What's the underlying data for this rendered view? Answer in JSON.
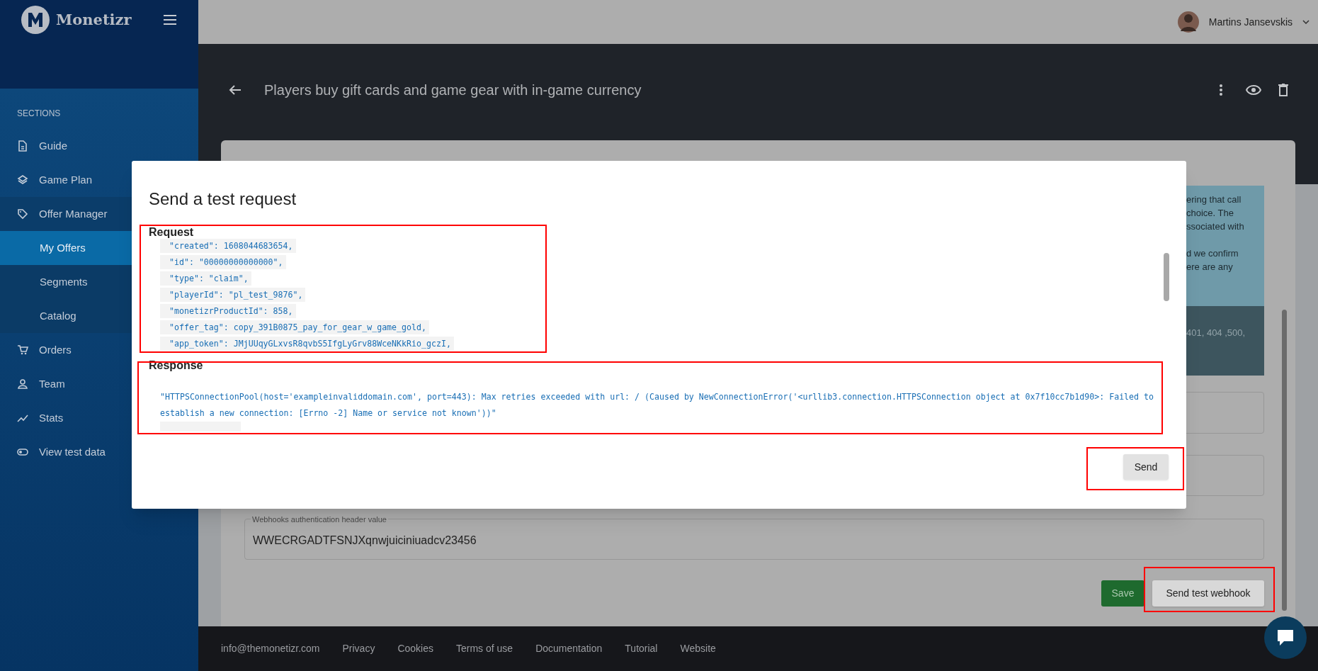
{
  "header": {
    "logo": "Monetizr",
    "user": "Martins Jansevskis"
  },
  "sidebar": {
    "section_title": "SECTIONS",
    "items": [
      {
        "label": "Guide",
        "selected": false
      },
      {
        "label": "Game Plan",
        "selected": false
      },
      {
        "label": "Offer Manager",
        "selected": false,
        "expanded": true,
        "children": [
          {
            "label": "My Offers",
            "selected": true
          },
          {
            "label": "Segments",
            "selected": false
          },
          {
            "label": "Catalog",
            "selected": false
          }
        ]
      },
      {
        "label": "Orders",
        "selected": false
      },
      {
        "label": "Team",
        "selected": false
      },
      {
        "label": "Stats",
        "selected": false
      },
      {
        "label": "View test data",
        "selected": false
      }
    ]
  },
  "page": {
    "title": "Players buy gift cards and game gear with in-game currency",
    "info_paragraphs": [
      [
        "ering that call",
        "choice. The",
        "ssociated with"
      ],
      [
        "d we confirm",
        "ere are any"
      ]
    ],
    "codes_fragment": "401, 404 ,500,",
    "auth_field": {
      "label": "Webhooks authentication header value",
      "value": "WWECRGADTFSNJXqnwjuiciniuadcv23456"
    },
    "buttons": [
      "Save",
      "Send test webhook"
    ]
  },
  "footer": {
    "links": [
      "info@themonetizr.com",
      "Privacy",
      "Cookies",
      "Terms of use",
      "Documentation",
      "Tutorial",
      "Website"
    ]
  },
  "modal": {
    "title": "Send a test request",
    "request_heading": "Request",
    "request_lines": [
      "\"created\": 1608044683654,",
      "\"id\": \"00000000000000\",",
      "\"type\": \"claim\",",
      "\"playerId\": \"pl_test_9876\",",
      "\"monetizrProductId\": 858,",
      "\"offer_tag\": copy_391B0875_pay_for_gear_w_game_gold,",
      "\"app_token\": JMjUUqyGLxvsR8qvbS5IfgLyGrv88WceNKkRio_gczI,"
    ],
    "response_heading": "Response",
    "response_text": "\"HTTPSConnectionPool(host='exampleinvaliddomain.com', port=443): Max retries exceeded with url: / (Caused by NewConnectionError('<urllib3.connection.HTTPSConnection object at 0x7f10cc7b1d90>: Failed to establish a new connection: [Errno -2] Name or service not known'))\"",
    "send_button": "Send"
  }
}
